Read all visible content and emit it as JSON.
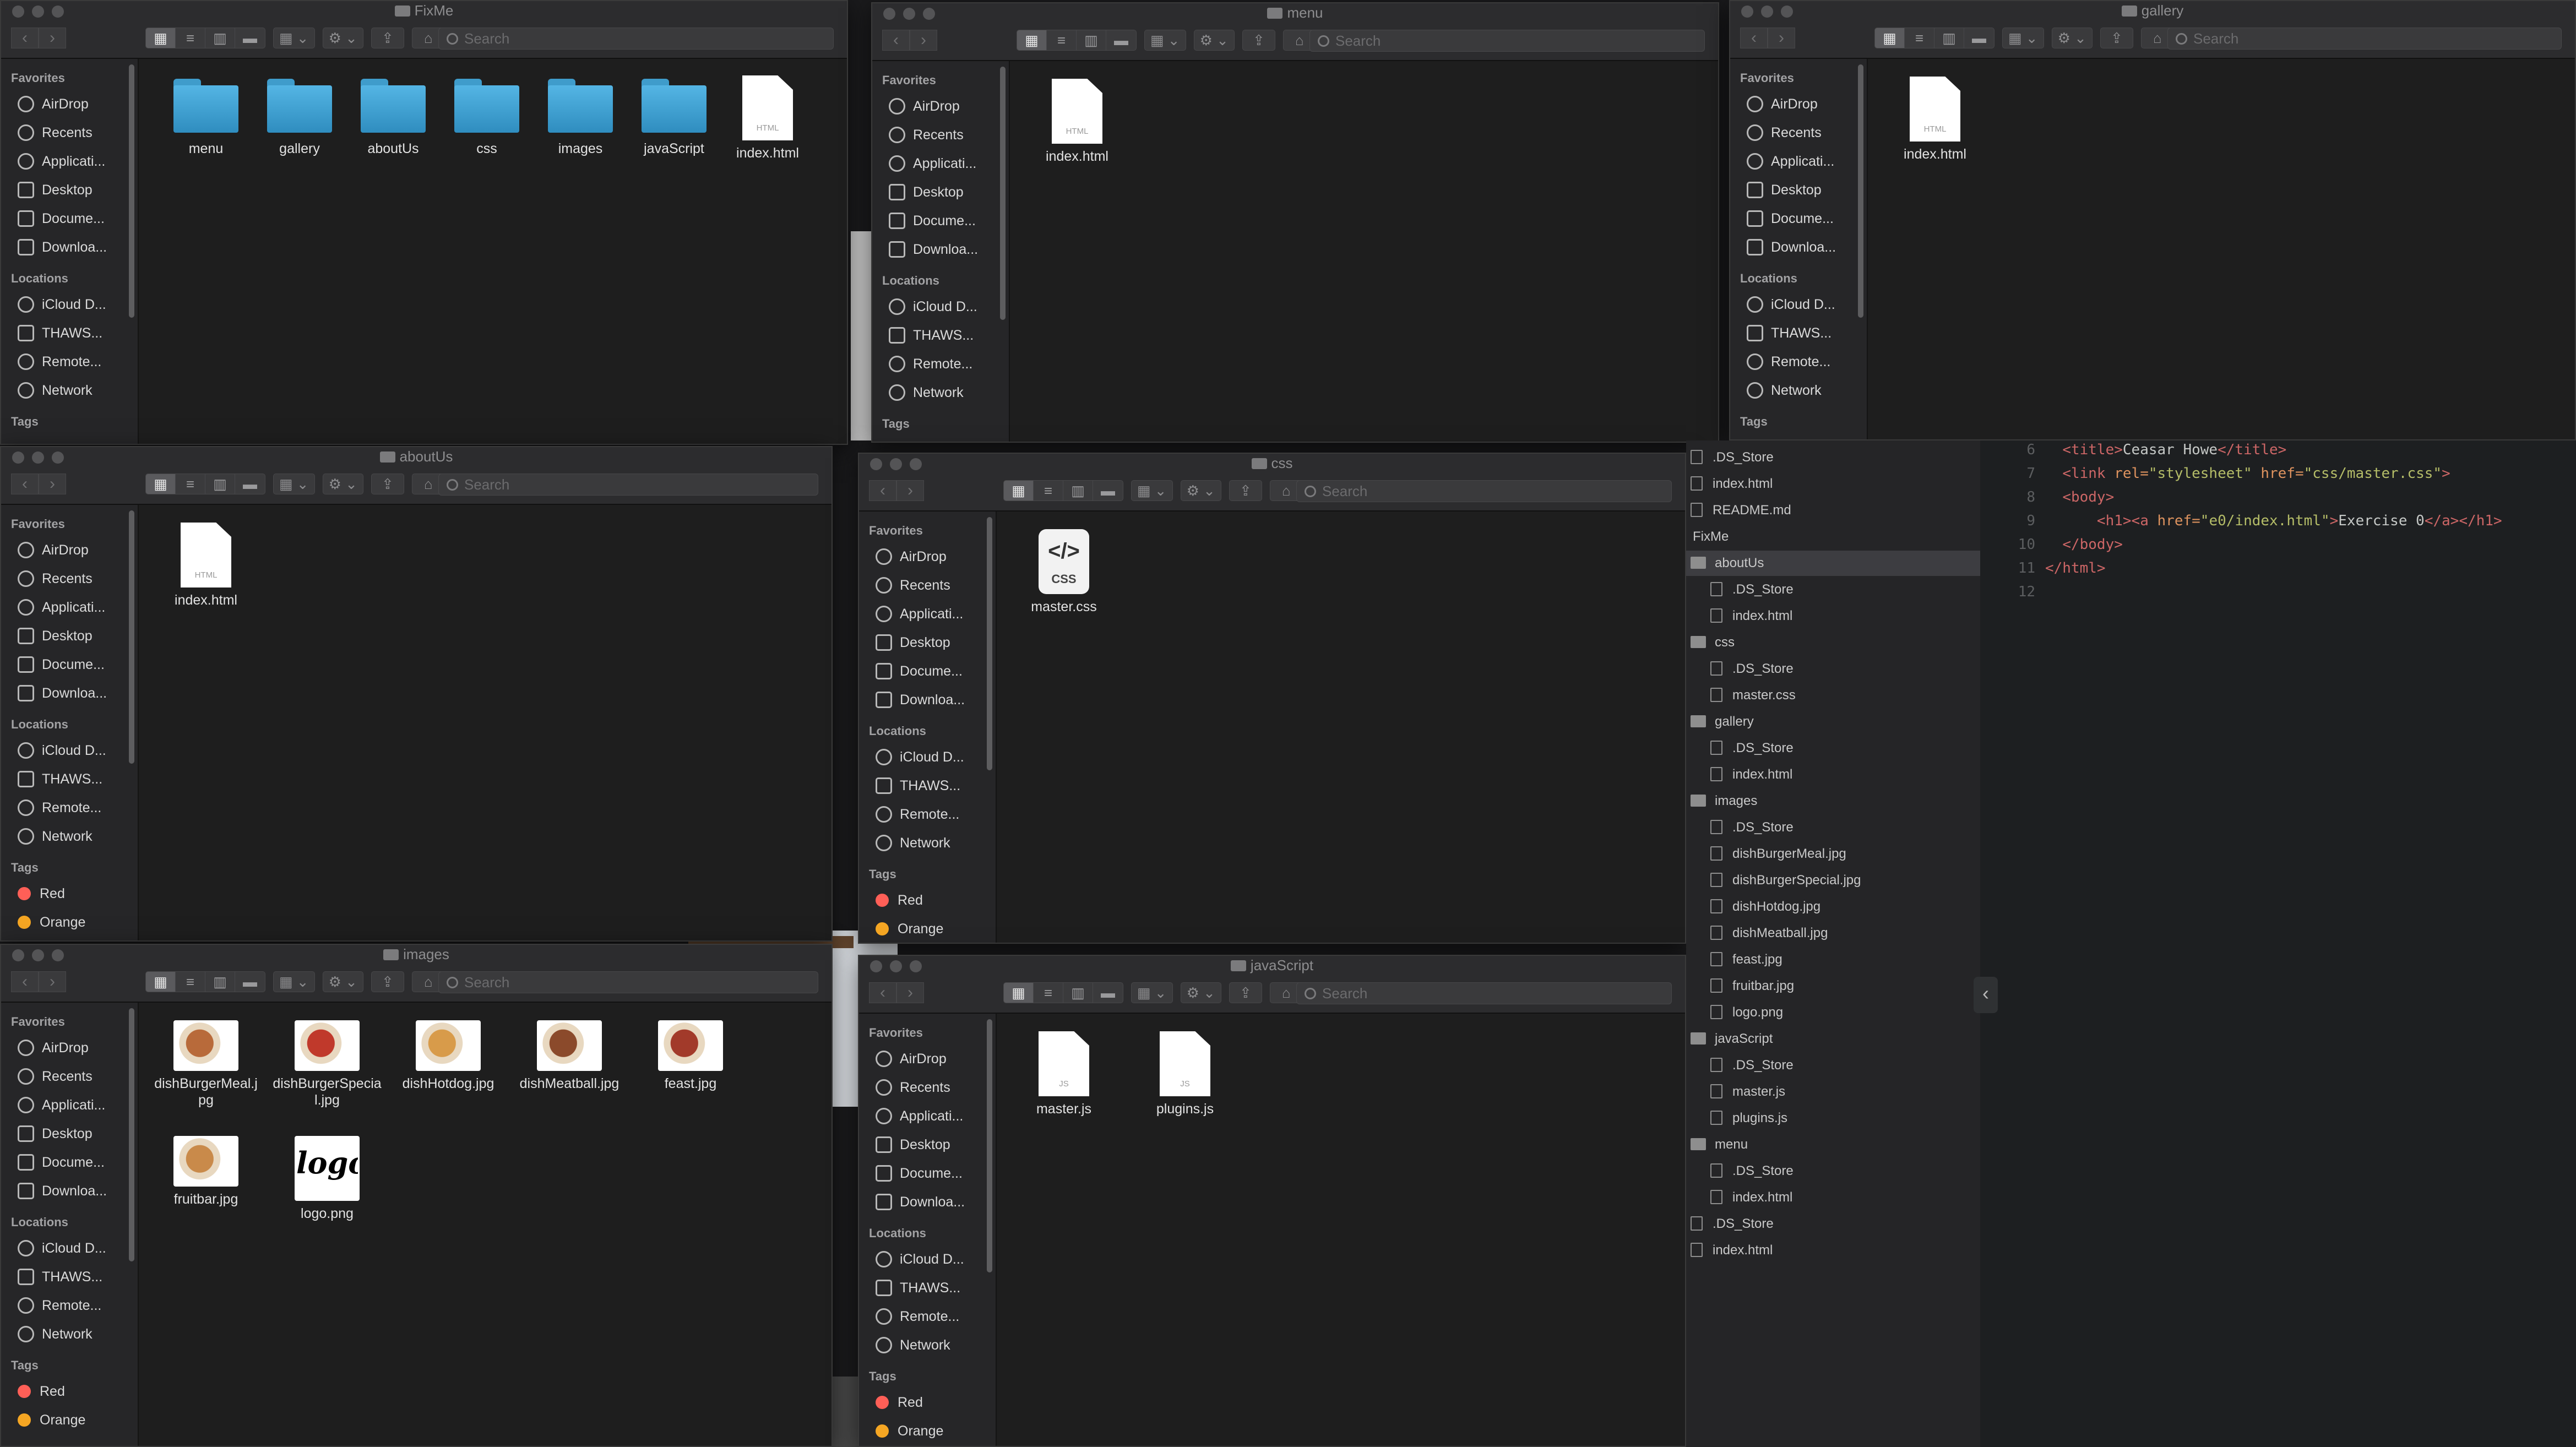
{
  "sidebar": {
    "favorites_title": "Favorites",
    "favorites": [
      "AirDrop",
      "Recents",
      "Applicati...",
      "Desktop",
      "Docume...",
      "Downloa..."
    ],
    "locations_title": "Locations",
    "locations": [
      "iCloud D...",
      "THAWS...",
      "Remote...",
      "Network"
    ],
    "tags_title": "Tags",
    "tags": [
      {
        "label": "Red",
        "color": "#ff5f57"
      },
      {
        "label": "Orange",
        "color": "#f5a623"
      }
    ]
  },
  "search_placeholder": "Search",
  "windows": {
    "fixme": {
      "title": "FixMe",
      "items": [
        {
          "label": "menu",
          "kind": "folder"
        },
        {
          "label": "gallery",
          "kind": "folder"
        },
        {
          "label": "aboutUs",
          "kind": "folder"
        },
        {
          "label": "css",
          "kind": "folder"
        },
        {
          "label": "images",
          "kind": "folder"
        },
        {
          "label": "javaScript",
          "kind": "folder"
        },
        {
          "label": "index.html",
          "kind": "html",
          "badge": "HTML"
        }
      ]
    },
    "menu": {
      "title": "menu",
      "items": [
        {
          "label": "index.html",
          "kind": "html",
          "badge": "HTML"
        }
      ]
    },
    "gallery": {
      "title": "gallery",
      "items": [
        {
          "label": "index.html",
          "kind": "html",
          "badge": "HTML"
        }
      ]
    },
    "aboutus": {
      "title": "aboutUs",
      "items": [
        {
          "label": "index.html",
          "kind": "html",
          "badge": "HTML"
        }
      ]
    },
    "css": {
      "title": "css",
      "items": [
        {
          "label": "master.css",
          "kind": "css",
          "badge": "CSS",
          "glyph": "</>"
        }
      ]
    },
    "images": {
      "title": "images",
      "items": [
        {
          "label": "dishBurgerMeal.jpg",
          "kind": "image"
        },
        {
          "label": "dishBurgerSpecial.jpg",
          "kind": "image"
        },
        {
          "label": "dishHotdog.jpg",
          "kind": "image"
        },
        {
          "label": "dishMeatball.jpg",
          "kind": "image"
        },
        {
          "label": "feast.jpg",
          "kind": "image"
        },
        {
          "label": "fruitbar.jpg",
          "kind": "image"
        },
        {
          "label": "logo.png",
          "kind": "logo",
          "glyph": "logo"
        }
      ]
    },
    "javascript": {
      "title": "javaScript",
      "items": [
        {
          "label": "master.js",
          "kind": "js",
          "badge": "JS"
        },
        {
          "label": "plugins.js",
          "kind": "js",
          "badge": "JS"
        }
      ]
    }
  },
  "file_tree": [
    {
      "label": ".DS_Store",
      "type": "file",
      "depth": 0
    },
    {
      "label": "index.html",
      "type": "file",
      "depth": 0
    },
    {
      "label": "README.md",
      "type": "file",
      "depth": 0
    },
    {
      "label": "FixMe",
      "type": "root",
      "depth": 0
    },
    {
      "label": "aboutUs",
      "type": "folder",
      "depth": 0,
      "selected": true
    },
    {
      "label": ".DS_Store",
      "type": "file",
      "depth": 1
    },
    {
      "label": "index.html",
      "type": "file",
      "depth": 1
    },
    {
      "label": "css",
      "type": "folder",
      "depth": 0
    },
    {
      "label": ".DS_Store",
      "type": "file",
      "depth": 1
    },
    {
      "label": "master.css",
      "type": "file",
      "depth": 1
    },
    {
      "label": "gallery",
      "type": "folder",
      "depth": 0
    },
    {
      "label": ".DS_Store",
      "type": "file",
      "depth": 1
    },
    {
      "label": "index.html",
      "type": "file",
      "depth": 1
    },
    {
      "label": "images",
      "type": "folder",
      "depth": 0
    },
    {
      "label": ".DS_Store",
      "type": "file",
      "depth": 1
    },
    {
      "label": "dishBurgerMeal.jpg",
      "type": "image",
      "depth": 1
    },
    {
      "label": "dishBurgerSpecial.jpg",
      "type": "image",
      "depth": 1
    },
    {
      "label": "dishHotdog.jpg",
      "type": "image",
      "depth": 1
    },
    {
      "label": "dishMeatball.jpg",
      "type": "image",
      "depth": 1
    },
    {
      "label": "feast.jpg",
      "type": "image",
      "depth": 1
    },
    {
      "label": "fruitbar.jpg",
      "type": "image",
      "depth": 1
    },
    {
      "label": "logo.png",
      "type": "image",
      "depth": 1
    },
    {
      "label": "javaScript",
      "type": "folder",
      "depth": 0
    },
    {
      "label": ".DS_Store",
      "type": "file",
      "depth": 1
    },
    {
      "label": "master.js",
      "type": "file",
      "depth": 1
    },
    {
      "label": "plugins.js",
      "type": "file",
      "depth": 1
    },
    {
      "label": "menu",
      "type": "folder",
      "depth": 0
    },
    {
      "label": ".DS_Store",
      "type": "file",
      "depth": 1
    },
    {
      "label": "index.html",
      "type": "file",
      "depth": 1
    },
    {
      "label": ".DS_Store",
      "type": "file",
      "depth": 0
    },
    {
      "label": "index.html",
      "type": "file",
      "depth": 0
    }
  ],
  "code": {
    "line_numbers": [
      "6",
      "7",
      "8",
      "9",
      "10",
      "11",
      "12"
    ],
    "lines": [
      [
        {
          "t": "  "
        },
        {
          "t": "<title>",
          "c": "tg"
        },
        {
          "t": "Ceasar Howe"
        },
        {
          "t": "</title>",
          "c": "tg"
        }
      ],
      [
        {
          "t": "  "
        },
        {
          "t": "<link ",
          "c": "tg"
        },
        {
          "t": "rel=",
          "c": "at"
        },
        {
          "t": "\"stylesheet\"",
          "c": "st"
        },
        {
          "t": " href=",
          "c": "at"
        },
        {
          "t": "\"css/master.css\"",
          "c": "st"
        },
        {
          "t": ">",
          "c": "tg"
        }
      ],
      [
        {
          "t": "  "
        },
        {
          "t": "<body>",
          "c": "tg"
        }
      ],
      [
        {
          "t": "      "
        },
        {
          "t": "<h1>",
          "c": "tg"
        },
        {
          "t": "<a ",
          "c": "tg"
        },
        {
          "t": "href=",
          "c": "at"
        },
        {
          "t": "\"e0/index.html\"",
          "c": "st"
        },
        {
          "t": ">",
          "c": "tg"
        },
        {
          "t": "Exercise 0"
        },
        {
          "t": "</a>",
          "c": "tg"
        },
        {
          "t": "</h1>",
          "c": "tg"
        }
      ],
      [
        {
          "t": "  "
        },
        {
          "t": "</body>",
          "c": "tg"
        }
      ],
      [
        {
          "t": "</html>",
          "c": "tg"
        }
      ],
      [
        {
          "t": ""
        }
      ]
    ]
  },
  "colors": {
    "accent": "#3f9ccb",
    "tag_red": "#ff5f57",
    "tag_orange": "#f5a623"
  },
  "icons": {
    "back": "chevron-left",
    "forward": "chevron-right",
    "collapse": "chevron-left"
  }
}
